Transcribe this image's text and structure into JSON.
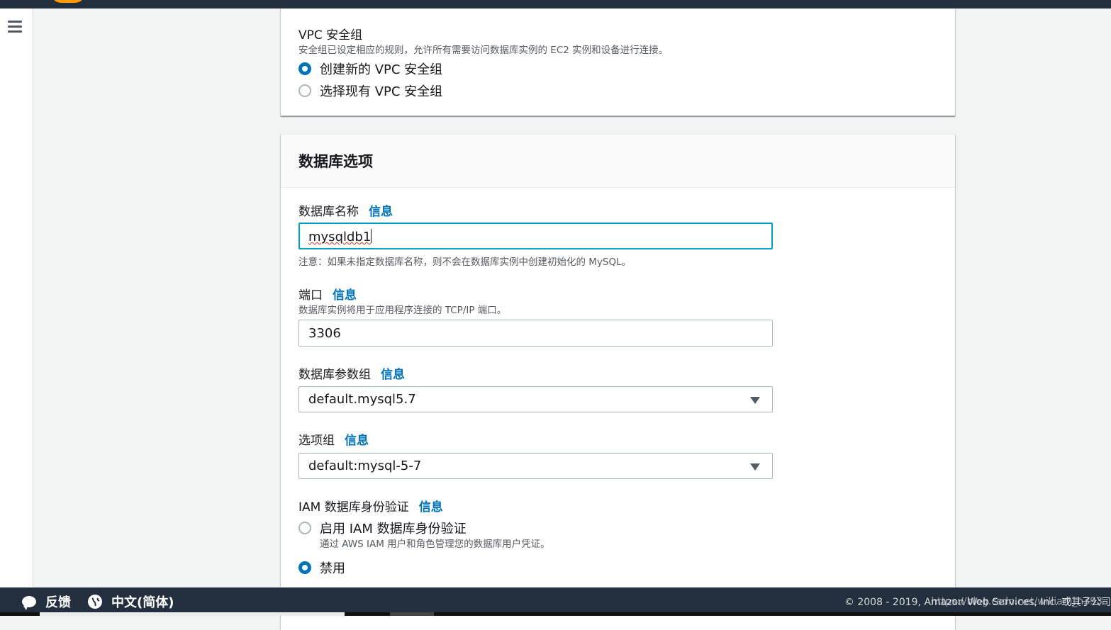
{
  "vpc_section": {
    "title": "VPC 安全组",
    "description": "安全组已设定相应的规则，允许所有需要访问数据库实例的 EC2 实例和设备进行连接。",
    "options": [
      {
        "label": "创建新的 VPC 安全组",
        "checked": true
      },
      {
        "label": "选择现有 VPC 安全组",
        "checked": false
      }
    ]
  },
  "db_options": {
    "title": "数据库选项",
    "info_label": "信息",
    "db_name": {
      "label": "数据库名称",
      "value": "mysqldb1",
      "note": "注意：如果未指定数据库名称，则不会在数据库实例中创建初始化的 MySQL。"
    },
    "port": {
      "label": "端口",
      "description": "数据库实例将用于应用程序连接的 TCP/IP 端口。",
      "value": "3306"
    },
    "param_group": {
      "label": "数据库参数组",
      "value": "default.mysql5.7"
    },
    "option_group": {
      "label": "选项组",
      "value": "default:mysql-5-7"
    },
    "iam_auth": {
      "label": "IAM 数据库身份验证",
      "options": [
        {
          "label": "启用 IAM 数据库身份验证",
          "description": "通过 AWS IAM 用户和角色管理您的数据库用户凭证。",
          "checked": false
        },
        {
          "label": "禁用",
          "checked": true
        }
      ]
    }
  },
  "footer": {
    "feedback": "反馈",
    "language": "中文(简体)",
    "copyright": "© 2008 - 2019, Amazon Web Services, Inc. 或其子公司",
    "watermark": "https://blog.csdn.net/william_n393"
  },
  "colors": {
    "accent": "#0073bb",
    "focus": "#00a1c9",
    "nav_dark": "#232f3e",
    "aws_orange": "#ff9900"
  }
}
